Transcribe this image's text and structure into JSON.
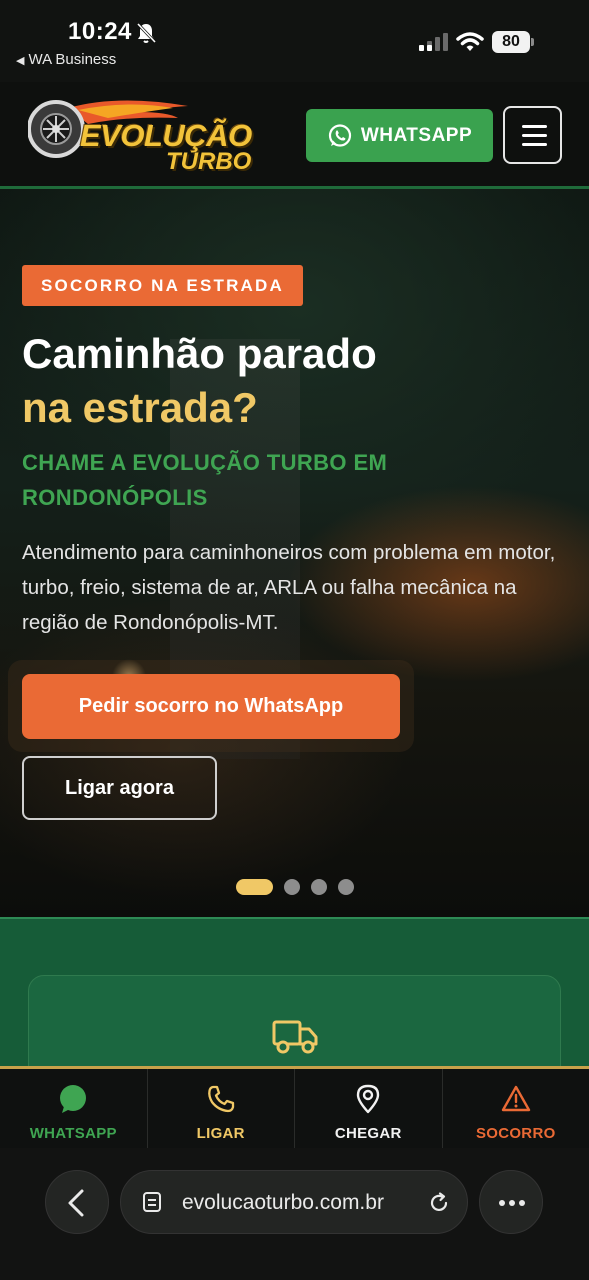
{
  "status_bar": {
    "time": "10:24",
    "back_app": "WA Business",
    "battery": "80"
  },
  "header": {
    "logo_word1": "EVOLUÇÃO",
    "logo_word2": "TURBO",
    "whatsapp_label": "WHATSAPP"
  },
  "hero": {
    "tag": "SOCORRO NA ESTRADA",
    "title_line1": "Caminhão parado",
    "title_line2": "na estrada?",
    "subtitle": "CHAME A EVOLUÇÃO TURBO EM RONDONÓPOLIS",
    "description": "Atendimento para caminhoneiros com problema em motor, turbo, freio, sistema de ar, ARLA ou falha mecânica na região de Rondonópolis-MT.",
    "cta_primary": "Pedir socorro no WhatsApp",
    "cta_secondary": "Ligar agora",
    "carousel_active_index": 1,
    "carousel_total": 4
  },
  "bottom_nav": {
    "items": [
      {
        "label": "WHATSAPP",
        "icon": "whatsapp-icon",
        "color": "#3fa552"
      },
      {
        "label": "LIGAR",
        "icon": "phone-icon",
        "color": "#f0c866"
      },
      {
        "label": "CHEGAR",
        "icon": "map-pin-icon",
        "color": "#f2f2f2"
      },
      {
        "label": "SOCORRO",
        "icon": "warning-icon",
        "color": "#ea6a35"
      }
    ]
  },
  "browser": {
    "url": "evolucaoturbo.com.br"
  },
  "colors": {
    "accent_orange": "#ea6a35",
    "accent_gold": "#f0c866",
    "brand_green": "#3fa552",
    "section_green": "#165c38"
  }
}
